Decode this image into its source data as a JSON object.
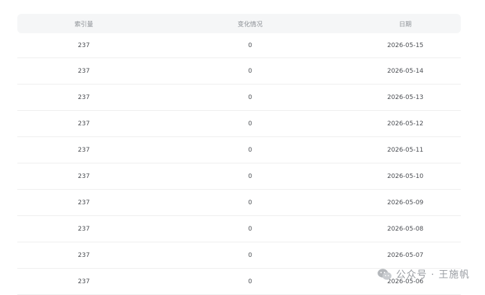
{
  "table": {
    "columns": [
      "索引量",
      "变化情况",
      "日期"
    ],
    "rows": [
      {
        "index": "237",
        "change": "0",
        "date": "2026-05-15"
      },
      {
        "index": "237",
        "change": "0",
        "date": "2026-05-14"
      },
      {
        "index": "237",
        "change": "0",
        "date": "2026-05-13"
      },
      {
        "index": "237",
        "change": "0",
        "date": "2026-05-12"
      },
      {
        "index": "237",
        "change": "0",
        "date": "2026-05-11"
      },
      {
        "index": "237",
        "change": "0",
        "date": "2026-05-10"
      },
      {
        "index": "237",
        "change": "0",
        "date": "2026-05-09"
      },
      {
        "index": "237",
        "change": "0",
        "date": "2026-05-08"
      },
      {
        "index": "237",
        "change": "0",
        "date": "2026-05-07"
      },
      {
        "index": "237",
        "change": "0",
        "date": "2026-05-06"
      }
    ]
  },
  "watermark": {
    "text": "公众号 · 王施帆",
    "icon": "wechat-icon",
    "color": "#9a9ea3"
  }
}
